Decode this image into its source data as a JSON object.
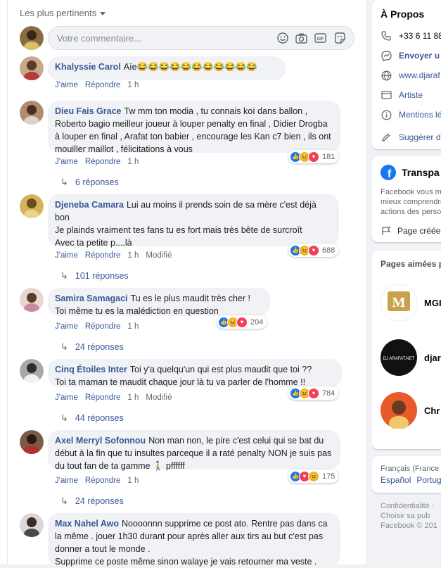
{
  "feed": {
    "sort_label": "Les plus pertinents",
    "composer_placeholder": "Votre commentaire...",
    "composer_icons": [
      "emoji-icon",
      "camera-icon",
      "gif-icon",
      "sticker-icon"
    ]
  },
  "actions": {
    "like": "J'aime",
    "reply": "Répondre",
    "edited": "Modifié"
  },
  "comments": [
    {
      "author": "Khalyssie Carol",
      "text": "Aïe😂😂😂😂😂😂😂😂😂😂😂",
      "time": "1 h",
      "reactions": null,
      "reaction_count": "",
      "replies": "",
      "edited": false
    },
    {
      "author": "Dieu Fais Grace",
      "text": "Tw mm ton modia , tu connais koï dans ballon , Roberto bagio meilleur joueur à louper penalty en final , Didier Drogba à louper en final , Arafat ton babier , encourage les Kan c7 bien , ils ont mouiller maillot , félicitations à vous",
      "time": "1 h",
      "reactions": [
        "like",
        "haha",
        "love"
      ],
      "reaction_count": "181",
      "replies": "6 réponses",
      "edited": false
    },
    {
      "author": "Djeneba Camara",
      "text": "Lui au moins il prends soin de sa mère c'est déjà bon\nJe plainds vraiment tes fans tu es fort mais très bête de surcroît\nAvec ta petite p....là",
      "time": "1 h",
      "reactions": [
        "like",
        "haha",
        "love"
      ],
      "reaction_count": "688",
      "replies": "101 réponses",
      "edited": true
    },
    {
      "author": "Samira Samagaci",
      "text": "Tu es le plus maudit très cher !\nToi même tu es la malédiction en question",
      "time": "1 h",
      "reactions": [
        "like",
        "haha",
        "love"
      ],
      "reaction_count": "204",
      "replies": "24 réponses",
      "edited": false
    },
    {
      "author": "Cinq Étoiles Inter",
      "text": "Toi y'a quelqu'un qui est plus maudit que toi ??\nToi ta maman te maudit chaque jour là tu va parler de l'homme !!",
      "time": "1 h",
      "reactions": [
        "like",
        "haha",
        "love"
      ],
      "reaction_count": "784",
      "replies": "44 réponses",
      "edited": true
    },
    {
      "author": "Axel Merryl Sofonnou",
      "text": "Non man non, le pire c'est celui qui se bat du début à la fin que tu insultes parceque il a raté penalty NON je suis pas du tout fan de ta gamme 🚶 pffffff",
      "time": "1 h",
      "reactions": [
        "like",
        "love",
        "haha"
      ],
      "reaction_count": "175",
      "replies": "24 réponses",
      "edited": false
    },
    {
      "author": "Max Nahel Awo",
      "text": "Noooonnn supprime ce post ato. Rentre pas dans ca la même . jouer 1h30 durant pour après aller aux tirs au but c'est pas donner a tout le monde .\nSupprime ce poste même sinon walaye je vais retourner ma veste .",
      "time": "",
      "reactions": null,
      "reaction_count": "",
      "replies": "",
      "edited": false
    }
  ],
  "sidebar": {
    "about_title": "À Propos",
    "phone": "+33 6 11 88",
    "messenger": "Envoyer u",
    "website": "www.djaraf",
    "category": "Artiste",
    "mentions": "Mentions lé",
    "suggest": "Suggérer d",
    "transparency_title": "Transpa",
    "transparency_text": "Facebook vous m\nmieux comprendre\nactions des perso",
    "page_created": "Page créée",
    "liked_pages_title": "Pages aimées p",
    "liked_pages": [
      {
        "name": "MGI",
        "logo_text": "M"
      },
      {
        "name": "djar",
        "logo_text": "DJ ARAFAT.NET"
      },
      {
        "name": "Chr",
        "logo_text": ""
      }
    ],
    "language_current": "Français (France",
    "language_1": "Español",
    "language_2": "Portug",
    "footer_1": "Confidentialité",
    "footer_1b": "·",
    "footer_2": "Choisir sa pub",
    "footer_3": "Facebook © 201"
  },
  "colors": {
    "like": "#1877f2",
    "haha": "#f7b125",
    "love": "#f33e58",
    "link": "#385898"
  }
}
